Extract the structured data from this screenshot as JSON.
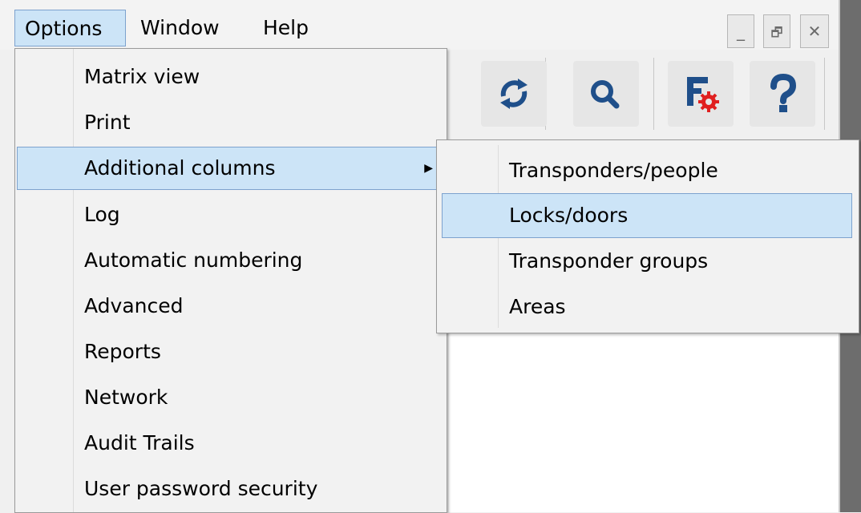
{
  "menubar": {
    "items": [
      {
        "label": "Options",
        "open": true
      },
      {
        "label": "Window"
      },
      {
        "label": "Help"
      }
    ]
  },
  "window_controls": {
    "minimize": "_",
    "restore": "🗗",
    "close": "✕"
  },
  "toolbar": {
    "icons": [
      "sync-icon",
      "search-icon",
      "settings-f-icon",
      "help-icon"
    ]
  },
  "options_menu": {
    "items": [
      {
        "label": "Matrix view"
      },
      {
        "label": "Print"
      },
      {
        "label": "Additional columns",
        "has_submenu": true,
        "highlighted": true
      },
      {
        "label": "Log"
      },
      {
        "label": "Automatic numbering"
      },
      {
        "label": "Advanced"
      },
      {
        "label": "Reports"
      },
      {
        "label": "Network"
      },
      {
        "label": "Audit Trails"
      },
      {
        "label": "User password security"
      }
    ],
    "submenu_arrow": "▶"
  },
  "additional_columns_submenu": {
    "items": [
      {
        "label": "Transponders/people"
      },
      {
        "label": "Locks/doors",
        "highlighted": true
      },
      {
        "label": "Transponder groups"
      },
      {
        "label": "Areas"
      }
    ]
  },
  "colors": {
    "highlight": "#cce4f7",
    "highlight_border": "#7da2ce",
    "accent_blue": "#1f4f8a",
    "accent_red": "#e02020"
  }
}
